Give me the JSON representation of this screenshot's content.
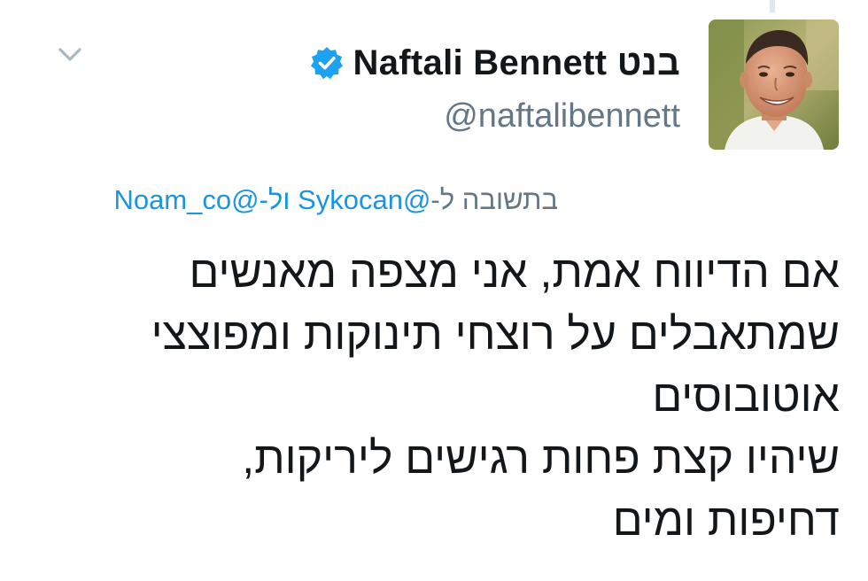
{
  "tweet": {
    "display_name": "Naftali Bennett בנט",
    "handle": "@naftalibennett",
    "reply": {
      "prefix": "בתשובה ל-",
      "mention_1": "@Sykocan",
      "joiner": " ול-",
      "mention_2": "@Noam_co"
    },
    "text": "אם הדיווח אמת, אני מצפה מאנשים\nשמתאבלים על רוצחי תינוקות ומפוצצי\nאוטובוסים\nשיהיו קצת פחות רגישים ליריקות,\nדחיפות ומים"
  },
  "icons": {
    "menu": "chevron-down-icon",
    "verified": "verified-badge-icon",
    "avatar": "profile-photo"
  },
  "colors": {
    "verified_blue": "#1da1f2",
    "mention_blue": "#1b95e0",
    "secondary_text": "#657786",
    "primary_text": "#14171a"
  }
}
